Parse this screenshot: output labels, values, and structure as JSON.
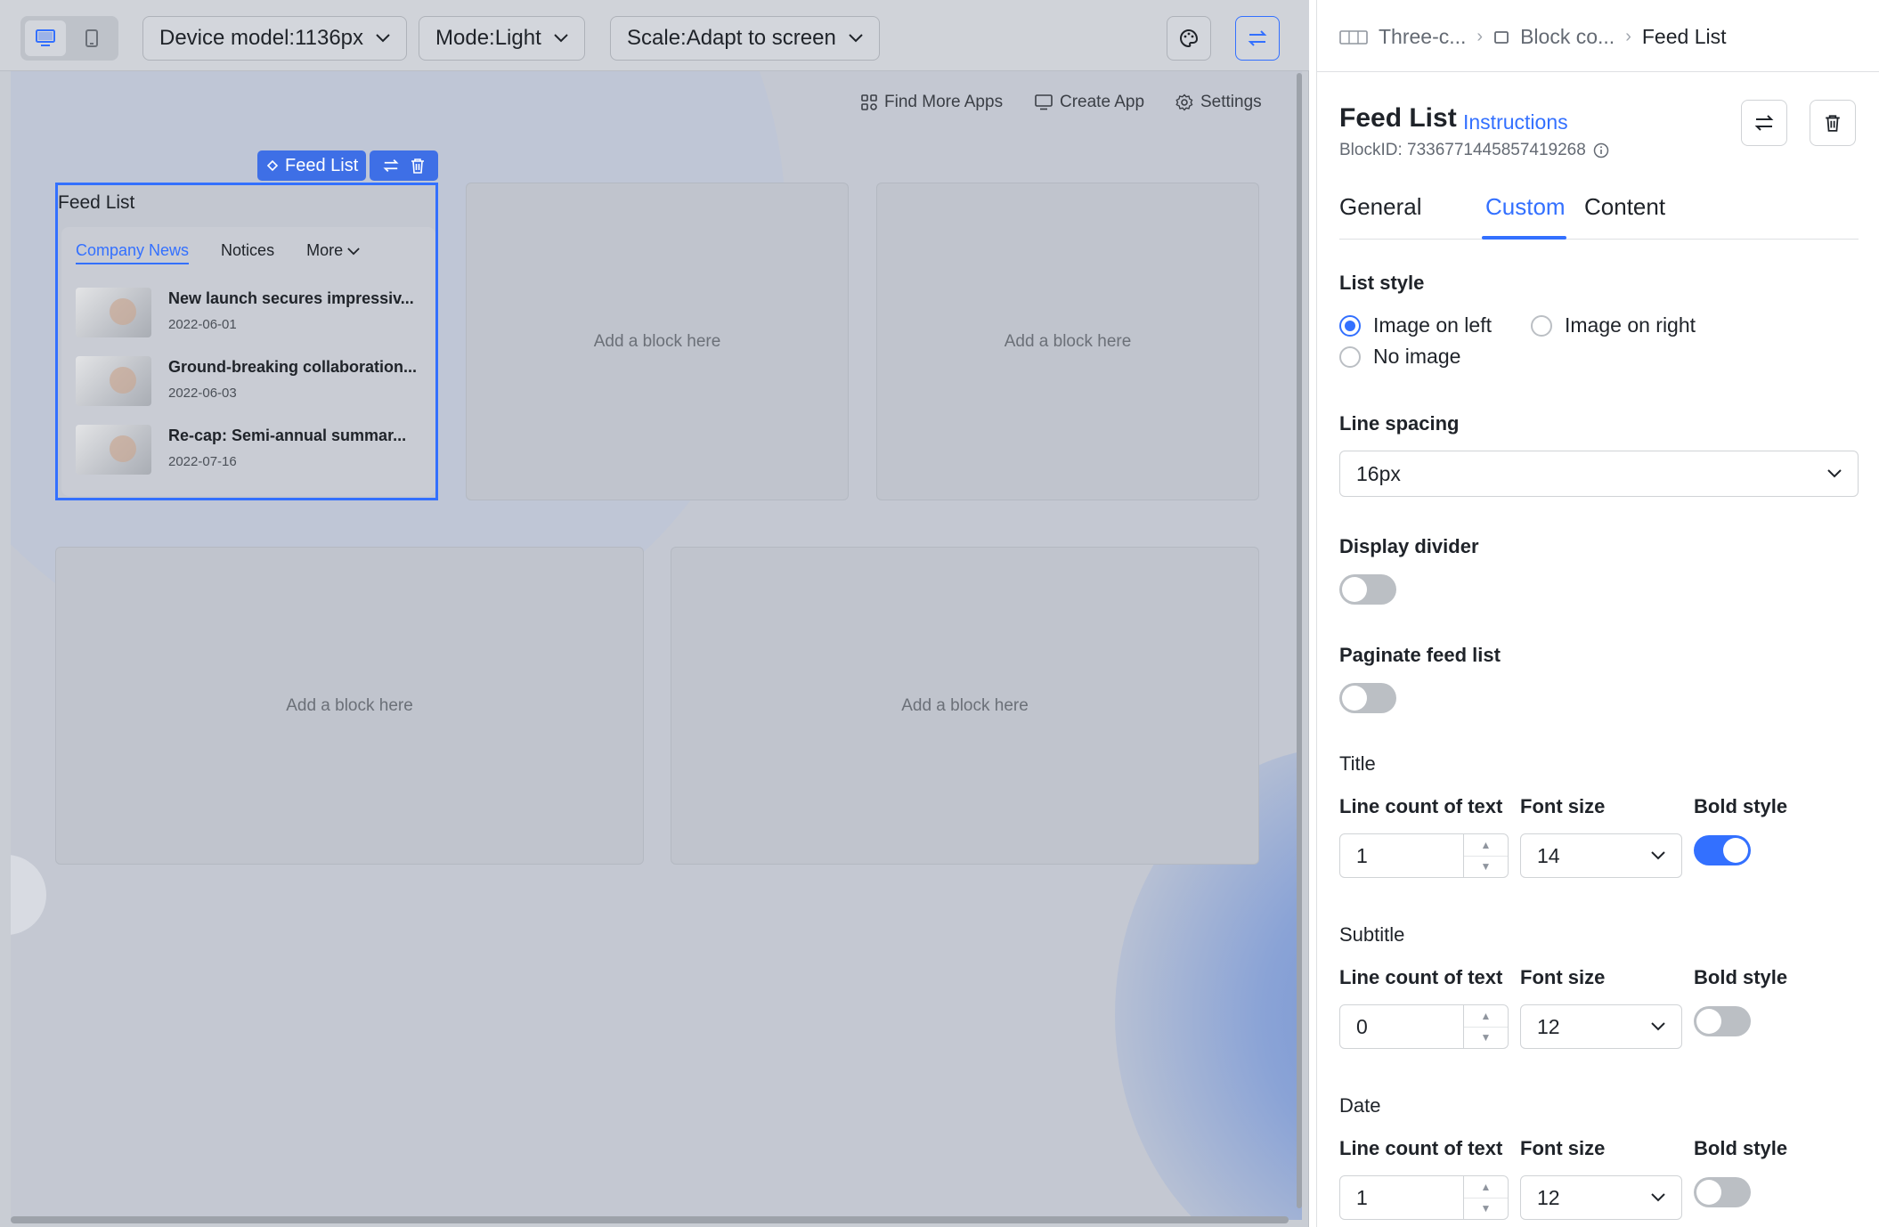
{
  "toolbar": {
    "device_model": "Device model:1136px",
    "mode": "Mode:Light",
    "scale": "Scale:Adapt to screen"
  },
  "app_nav": {
    "find_more_apps": "Find More Apps",
    "create_app": "Create App",
    "settings": "Settings"
  },
  "canvas": {
    "block_tag": "Feed List",
    "feed_block_title": "Feed List",
    "feed_tabs": [
      "Company News",
      "Notices",
      "More"
    ],
    "feed_items": [
      {
        "title": "New launch secures impressiv...",
        "date": "2022-06-01"
      },
      {
        "title": "Ground-breaking collaboration...",
        "date": "2022-06-03"
      },
      {
        "title": "Re-cap: Semi-annual summar...",
        "date": "2022-07-16"
      }
    ],
    "placeholder": "Add a block here"
  },
  "panel": {
    "breadcrumb": [
      "Three-c...",
      "Block co...",
      "Feed List"
    ],
    "title": "Feed List",
    "instructions": "Instructions",
    "block_id": "BlockID: 7336771445857419268",
    "tabs": [
      "General",
      "Custom",
      "Content"
    ],
    "active_tab": "Custom",
    "list_style": {
      "label": "List style",
      "options": [
        "Image on left",
        "Image on right",
        "No image"
      ],
      "selected": "Image on left"
    },
    "line_spacing": {
      "label": "Line spacing",
      "value": "16px"
    },
    "display_divider": {
      "label": "Display divider",
      "on": false
    },
    "paginate": {
      "label": "Paginate feed list",
      "on": false
    },
    "col_labels": {
      "line_count": "Line count of text",
      "font_size": "Font size",
      "bold": "Bold style"
    },
    "title_section": {
      "label": "Title",
      "line_count": "1",
      "font_size": "14",
      "bold": true
    },
    "subtitle_section": {
      "label": "Subtitle",
      "line_count": "0",
      "font_size": "12",
      "bold": false
    },
    "date_section": {
      "label": "Date",
      "line_count": "1",
      "font_size": "12",
      "bold": false
    }
  },
  "colors": {
    "accent": "#3370ff",
    "canvas_bg": "#c4c8d2",
    "panel_bg": "#ffffff"
  }
}
